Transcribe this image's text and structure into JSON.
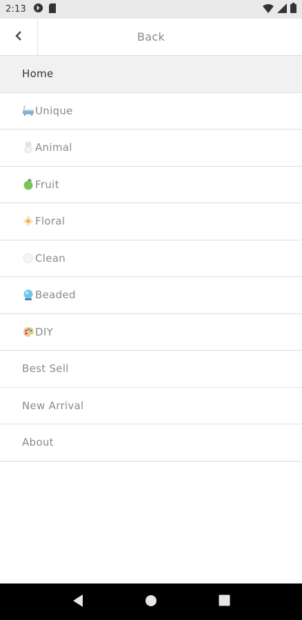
{
  "status_bar": {
    "time": "2:13",
    "icons_left": [
      "data-saver-icon",
      "sd-card-icon"
    ],
    "icons_right": [
      "wifi-icon",
      "signal-icon",
      "battery-icon"
    ]
  },
  "header": {
    "title": "Back",
    "back_icon": "chevron-left-icon"
  },
  "menu": {
    "items": [
      {
        "label": "Home",
        "icon": null,
        "active": true
      },
      {
        "label": "Unique",
        "icon": "bathtub-icon"
      },
      {
        "label": "Animal",
        "icon": "rabbit-icon"
      },
      {
        "label": "Fruit",
        "icon": "apple-icon"
      },
      {
        "label": "Floral",
        "icon": "flower-icon"
      },
      {
        "label": "Clean",
        "icon": "circle-icon"
      },
      {
        "label": "Beaded",
        "icon": "crystal-ball-icon"
      },
      {
        "label": "DIY",
        "icon": "palette-icon"
      },
      {
        "label": "Best Sell",
        "icon": null
      },
      {
        "label": "New Arrival",
        "icon": null
      },
      {
        "label": "About",
        "icon": null
      }
    ]
  },
  "nav_bar": {
    "buttons": [
      "back-triangle-icon",
      "home-circle-icon",
      "recents-square-icon"
    ]
  }
}
